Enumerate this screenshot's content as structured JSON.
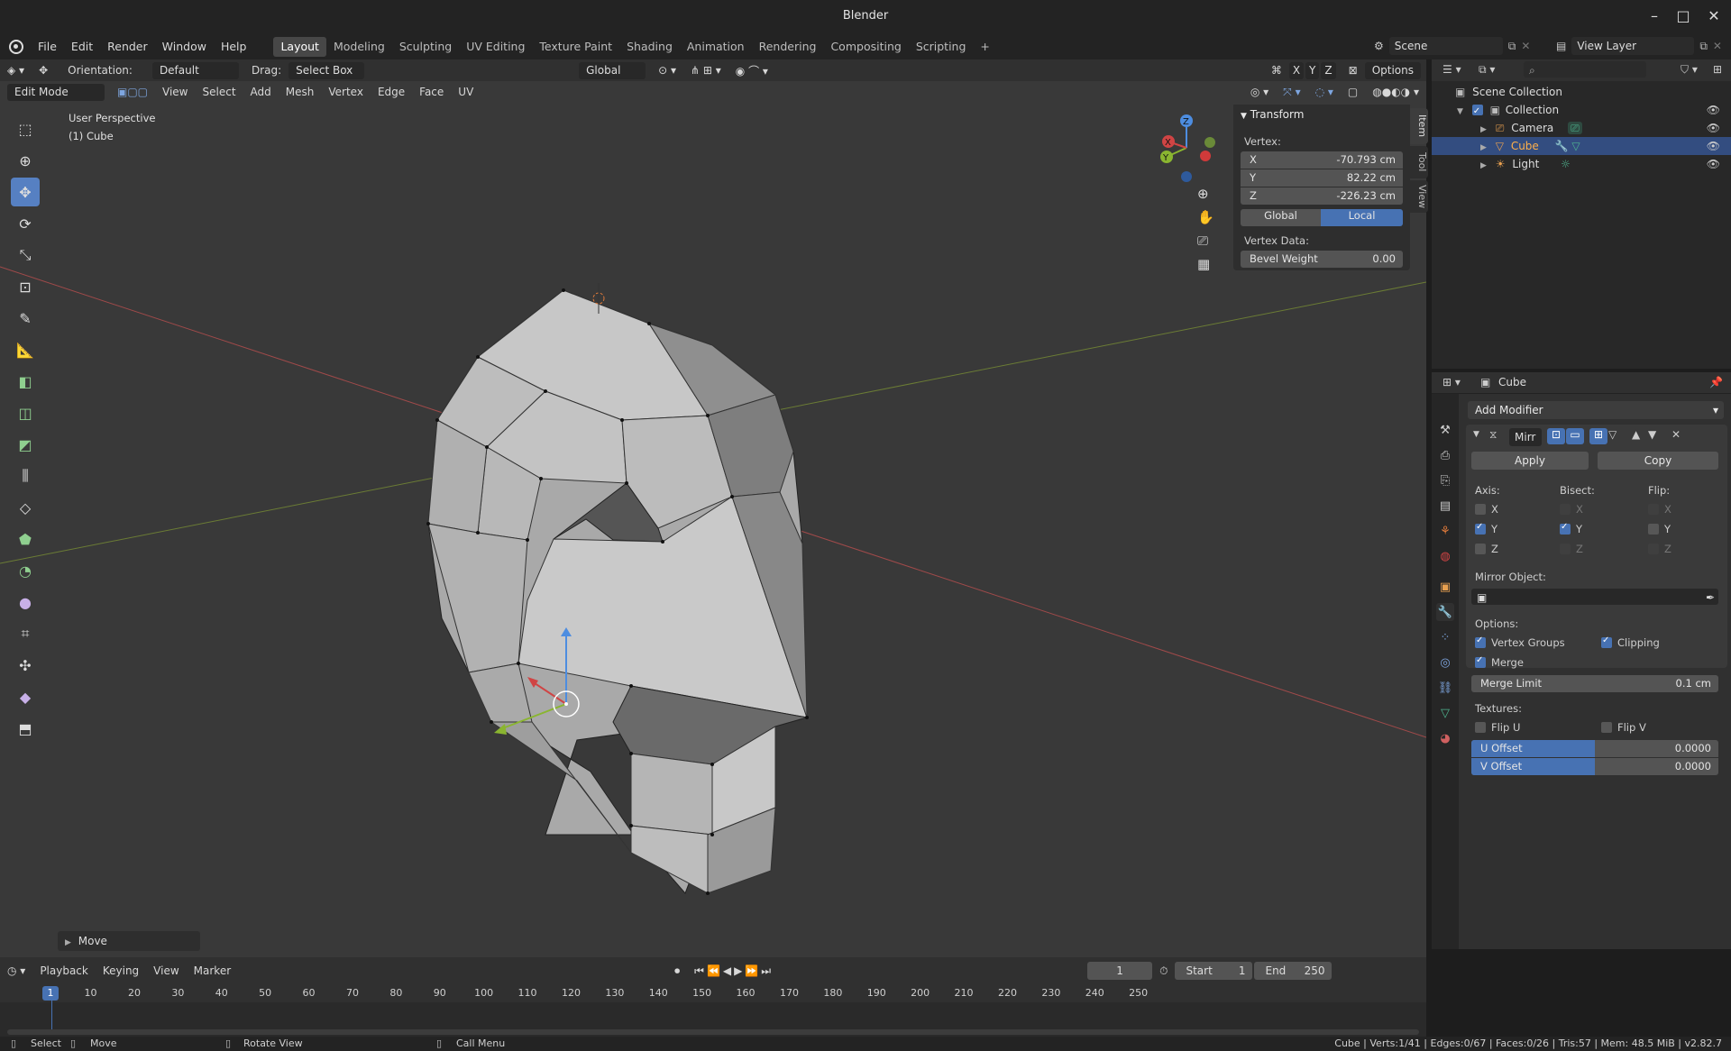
{
  "window": {
    "title": "Blender"
  },
  "menubar": {
    "menus": [
      "File",
      "Edit",
      "Render",
      "Window",
      "Help"
    ],
    "workspaces": [
      "Layout",
      "Modeling",
      "Sculpting",
      "UV Editing",
      "Texture Paint",
      "Shading",
      "Animation",
      "Rendering",
      "Compositing",
      "Scripting"
    ],
    "active_workspace": "Layout",
    "scene": "Scene",
    "view_layer": "View Layer"
  },
  "tool_header": {
    "orientation_label": "Orientation:",
    "orientation_value": "Default",
    "drag_label": "Drag:",
    "drag_value": "Select Box",
    "transform_orientation": "Global",
    "axes": [
      "X",
      "Y",
      "Z"
    ],
    "options": "Options"
  },
  "view_header": {
    "mode": "Edit Mode",
    "menus": [
      "View",
      "Select",
      "Add",
      "Mesh",
      "Vertex",
      "Edge",
      "Face",
      "UV"
    ]
  },
  "viewport": {
    "perspective": "User Perspective",
    "object": "(1) Cube",
    "last_op": "Move"
  },
  "gizmo": {
    "x": "X",
    "y": "Y",
    "z": "Z"
  },
  "npanel": {
    "title": "Transform",
    "vertex_label": "Vertex:",
    "x_label": "X",
    "x_value": "-70.793 cm",
    "y_label": "Y",
    "y_value": "82.22 cm",
    "z_label": "Z",
    "z_value": "-226.23 cm",
    "global": "Global",
    "local": "Local",
    "vertex_data_label": "Vertex Data:",
    "bevel_label": "Bevel Weight",
    "bevel_value": "0.00",
    "tabs": [
      "Item",
      "Tool",
      "View"
    ]
  },
  "outliner": {
    "root": "Scene Collection",
    "items": [
      {
        "name": "Collection"
      },
      {
        "name": "Camera"
      },
      {
        "name": "Cube"
      },
      {
        "name": "Light"
      }
    ]
  },
  "properties": {
    "object_name": "Cube",
    "add_modifier": "Add Modifier",
    "modifier_name": "Mirr",
    "apply": "Apply",
    "copy": "Copy",
    "axis_label": "Axis:",
    "bisect_label": "Bisect:",
    "flip_label": "Flip:",
    "x": "X",
    "y": "Y",
    "z": "Z",
    "mirror_object_label": "Mirror Object:",
    "options_label": "Options:",
    "vertex_groups": "Vertex Groups",
    "clipping": "Clipping",
    "merge": "Merge",
    "merge_limit_label": "Merge Limit",
    "merge_limit_value": "0.1 cm",
    "textures_label": "Textures:",
    "flip_u": "Flip U",
    "flip_v": "Flip V",
    "u_offset_label": "U Offset",
    "u_offset_value": "0.0000",
    "v_offset_label": "V Offset",
    "v_offset_value": "0.0000"
  },
  "timeline": {
    "menus": [
      "Playback",
      "Keying",
      "View",
      "Marker"
    ],
    "current_frame": "1",
    "start_label": "Start",
    "start_value": "1",
    "end_label": "End",
    "end_value": "250",
    "ticks": [
      "10",
      "20",
      "30",
      "40",
      "50",
      "60",
      "70",
      "80",
      "90",
      "100",
      "110",
      "120",
      "130",
      "140",
      "150",
      "160",
      "170",
      "180",
      "190",
      "200",
      "210",
      "220",
      "230",
      "240",
      "250"
    ],
    "playhead": "1"
  },
  "statusbar": {
    "select": "Select",
    "move": "Move",
    "rotate": "Rotate View",
    "call_menu": "Call Menu",
    "stats": "Cube | Verts:1/41 | Edges:0/67 | Faces:0/26 | Tris:57 | Mem: 48.5 MiB | v2.82.7"
  }
}
